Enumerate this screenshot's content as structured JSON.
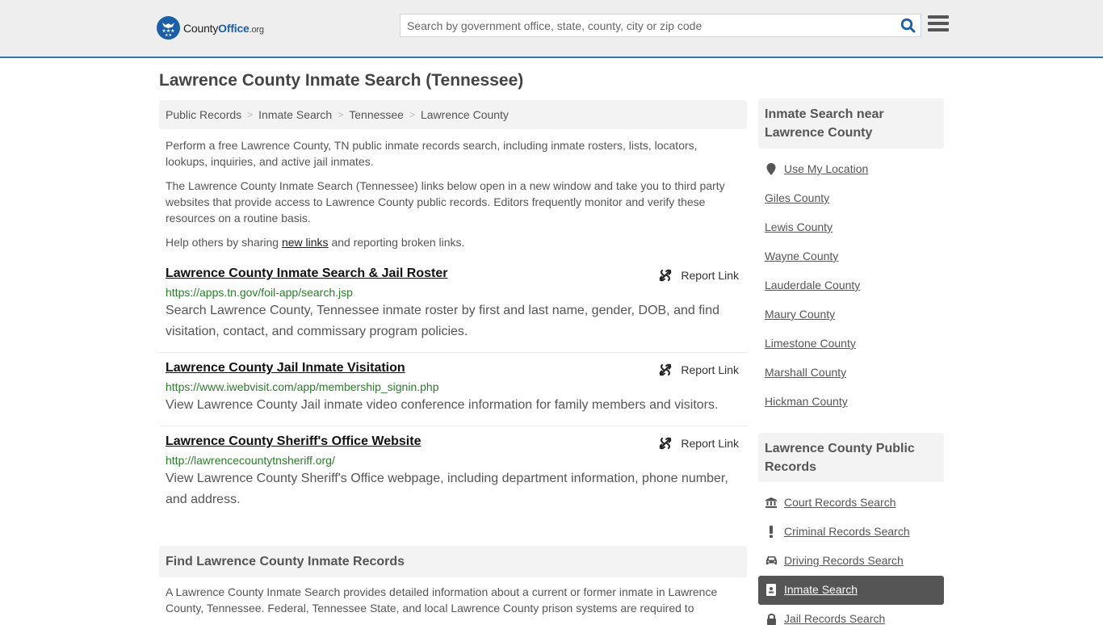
{
  "header": {
    "logo": {
      "county": "County",
      "office": "Office",
      "org": ".org"
    },
    "search_placeholder": "Search by government office, state, county, city or zip code",
    "icons": {
      "search": "search-icon",
      "menu": "hamburger-menu-icon"
    }
  },
  "page": {
    "title": "Lawrence County Inmate Search (Tennessee)",
    "breadcrumb": [
      "Public Records",
      "Inmate Search",
      "Tennessee",
      "Lawrence County"
    ],
    "breadcrumb_separator": ">",
    "intro": {
      "p1": "Perform a free Lawrence County, TN public inmate records search, including inmate rosters, lists, locators, lookups, inquiries, and active jail inmates.",
      "p2": "The Lawrence County Inmate Search (Tennessee) links below open in a new window and take you to third party websites that provide access to Lawrence County public records. Editors frequently monitor and verify these resources on a routine basis.",
      "p3_before": "Help others by sharing ",
      "p3_link": "new links",
      "p3_after": " and reporting broken links."
    }
  },
  "results": [
    {
      "title": "Lawrence County Inmate Search & Jail Roster",
      "url": "https://apps.tn.gov/foil-app/search.jsp",
      "description": "Search Lawrence County, Tennessee inmate roster by first and last name, gender, DOB, and find visitation, contact, and commissary program policies.",
      "report_label": "Report Link"
    },
    {
      "title": "Lawrence County Jail Inmate Visitation",
      "url": "https://www.iwebvisit.com/app/membership_signin.php",
      "description": "View Lawrence County Jail inmate video conference information for family members and visitors.",
      "report_label": "Report Link"
    },
    {
      "title": "Lawrence County Sheriff's Office Website",
      "url": "http://lawrencecountytnsheriff.org/",
      "description": "View Lawrence County Sheriff's Office webpage, including department information, phone number, and address.",
      "report_label": "Report Link"
    }
  ],
  "find_section": {
    "heading": "Find Lawrence County Inmate Records",
    "text": "A Lawrence County Inmate Search provides detailed information about a current or former inmate in Lawrence County, Tennessee. Federal, Tennessee State, and local Lawrence County prison systems are required to"
  },
  "sidebar": {
    "nearby_heading": "Inmate Search near Lawrence County",
    "use_location": "Use My Location",
    "nearby": [
      "Giles County",
      "Lewis County",
      "Wayne County",
      "Lauderdale County",
      "Maury County",
      "Limestone County",
      "Marshall County",
      "Hickman County"
    ],
    "records_heading": "Lawrence County Public Records",
    "records": [
      {
        "label": "Court Records Search",
        "icon": "courthouse-icon",
        "active": false
      },
      {
        "label": "Criminal Records Search",
        "icon": "exclamation-icon",
        "active": false
      },
      {
        "label": "Driving Records Search",
        "icon": "car-icon",
        "active": false
      },
      {
        "label": "Inmate Search",
        "icon": "id-badge-icon",
        "active": true
      },
      {
        "label": "Jail Records Search",
        "icon": "lock-icon",
        "active": false
      }
    ]
  },
  "colors": {
    "brand_blue": "#1c5fa6",
    "header_border": "#3a76a8",
    "url_green": "#2a7d2a",
    "active_bg": "#555555"
  }
}
